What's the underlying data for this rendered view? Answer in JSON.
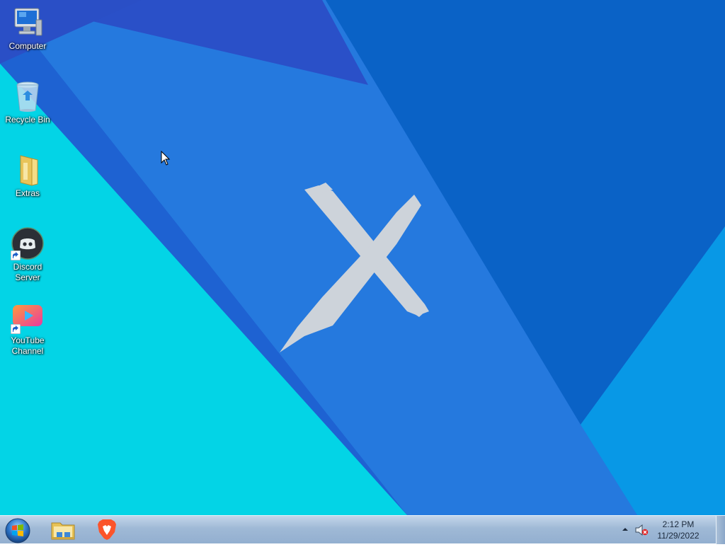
{
  "desktop": {
    "icons": [
      {
        "label": "Computer",
        "icon": "computer-icon"
      },
      {
        "label": "Recycle Bin",
        "icon": "recycle-bin-icon"
      },
      {
        "label": "Extras",
        "icon": "folder-icon"
      },
      {
        "label": "Discord Server",
        "icon": "discord-icon",
        "shortcut": true
      },
      {
        "label": "YouTube Channel",
        "icon": "youtube-icon",
        "shortcut": true
      }
    ],
    "wallpaper": {
      "logo_icon": "x-brush-logo",
      "colors": [
        "#1f4fc4",
        "#2577dd",
        "#0a5fc4",
        "#00c8e8",
        "#0790e0"
      ]
    }
  },
  "taskbar": {
    "start_icon": "windows-start-orb-icon",
    "pinned": [
      {
        "name": "File Explorer",
        "icon": "file-explorer-icon"
      },
      {
        "name": "Brave Browser",
        "icon": "brave-browser-icon"
      }
    ],
    "tray": {
      "overflow_icon": "show-hidden-icons-arrow",
      "volume_icon": "volume-muted-icon",
      "time": "2:12 PM",
      "date": "11/29/2022"
    }
  }
}
